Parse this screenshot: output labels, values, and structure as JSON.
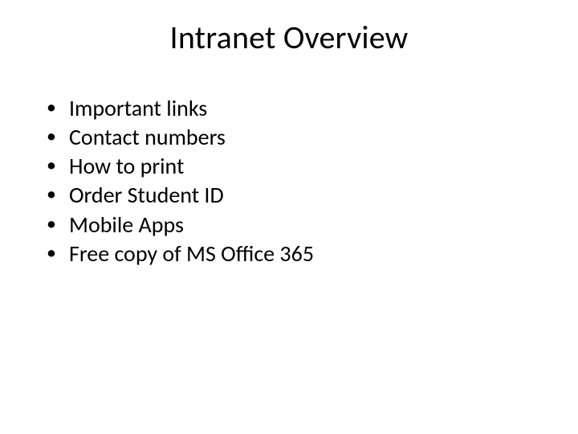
{
  "slide": {
    "title": "Intranet Overview",
    "bullets": [
      "Important links",
      "Contact numbers",
      "How to print",
      "Order Student ID",
      "Mobile Apps",
      "Free copy of MS Office 365"
    ]
  }
}
